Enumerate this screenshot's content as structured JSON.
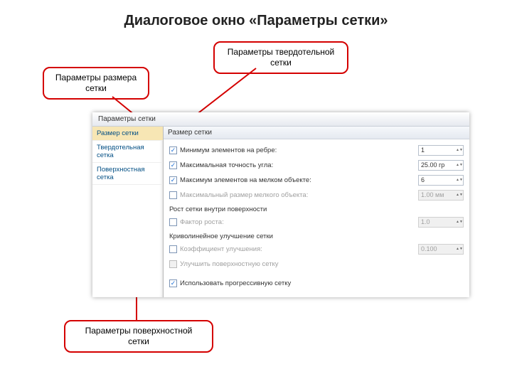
{
  "slide": {
    "title": "Диалоговое окно «Параметры сетки»"
  },
  "callouts": {
    "size": "Параметры размера сетки",
    "solid": "Параметры твердотельной сетки",
    "surf": "Параметры поверхностной сетки"
  },
  "dialog": {
    "title": "Параметры сетки",
    "panel_title": "Размер сетки",
    "nav": {
      "items": [
        {
          "label": "Размер сетки",
          "selected": true
        },
        {
          "label": "Твердотельная сетка",
          "selected": false
        },
        {
          "label": "Поверхностная сетка",
          "selected": false
        }
      ]
    },
    "rows": {
      "min_elem": {
        "label": "Минимум элементов на ребре:",
        "value": "1",
        "checked": true
      },
      "max_angle": {
        "label": "Максимальная точность угла:",
        "value": "25.00 гр",
        "checked": true
      },
      "max_elem": {
        "label": "Максимум элементов на мелком объекте:",
        "value": "6",
        "checked": true
      },
      "max_size": {
        "label": "Максимальный размер мелкого объекта:",
        "value": "1.00 мм",
        "checked": false
      },
      "section_growth": "Рост сетки внутри поверхности",
      "growth": {
        "label": "Фактор роста:",
        "value": "1.0",
        "checked": false
      },
      "section_curve": "Криволинейное улучшение сетки",
      "curve": {
        "label": "Коэффициент улучшения:",
        "value": "0.100",
        "checked": false
      },
      "improve": {
        "label": "Улучшить поверхностную сетку",
        "checked": false
      },
      "progressive": {
        "label": "Использовать прогрессивную сетку",
        "checked": true
      }
    }
  }
}
